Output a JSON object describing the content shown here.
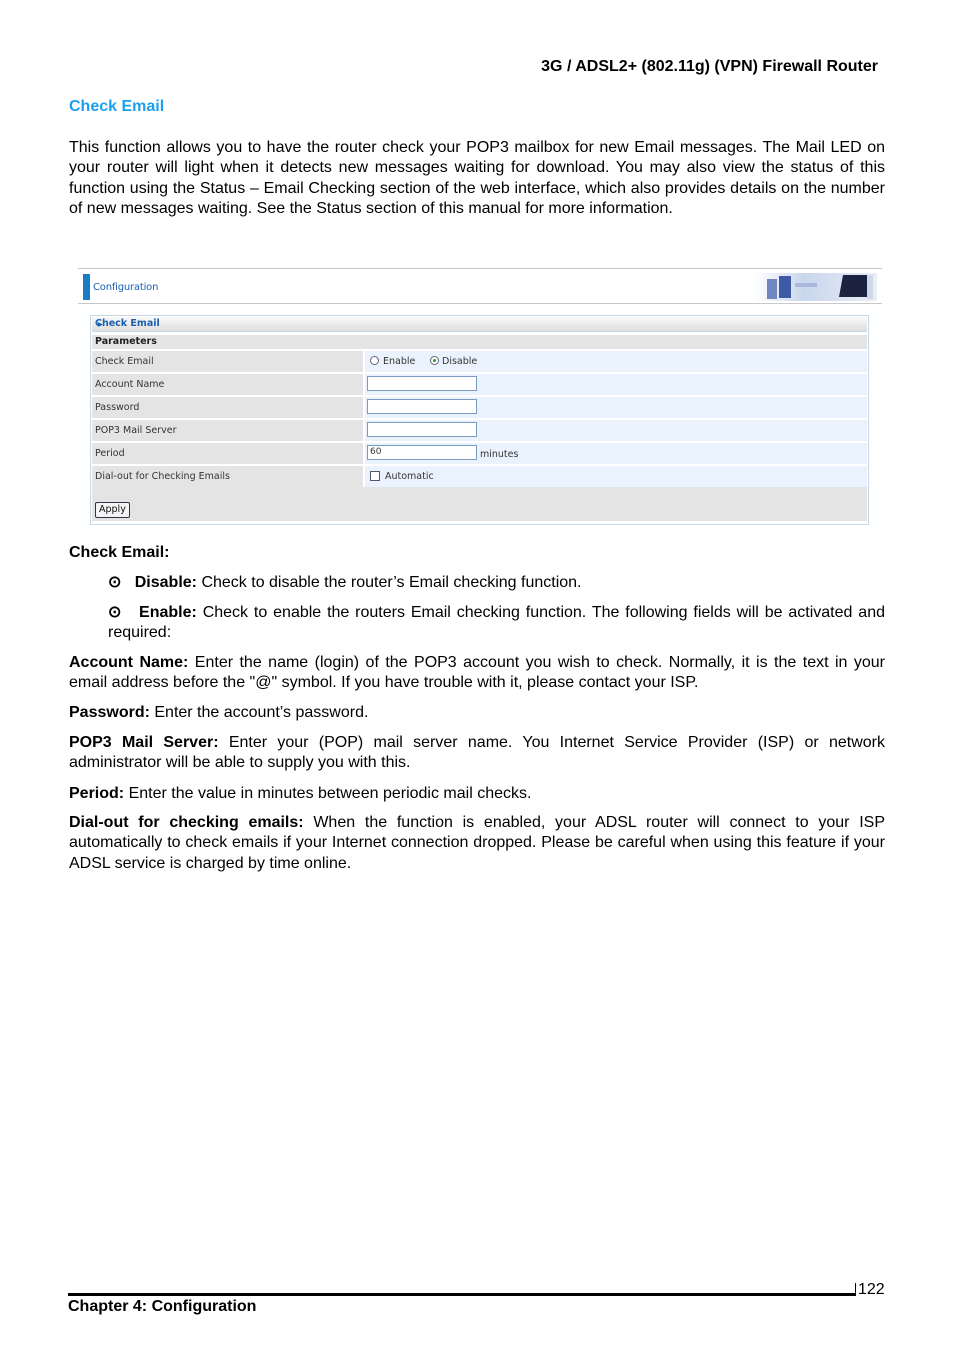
{
  "header": {
    "product": "3G / ADSL2+ (802.11g) (VPN) Firewall Router"
  },
  "section": {
    "title": "Check Email",
    "intro": "This function allows you to have the router check your POP3 mailbox for new Email messages. The Mail LED on your router will light when it detects new messages waiting for download. You may also view the status of this function using the Status – Email Checking section of the web interface, which also provides details on the number of new messages waiting. See the Status section of this manual for more information."
  },
  "screenshot": {
    "bar_title": "Configuration",
    "form_title": "Check Email",
    "params_label": "Parameters",
    "rows": {
      "check_email": {
        "label": "Check Email",
        "options": [
          "Enable",
          "Disable"
        ],
        "selected": "Disable"
      },
      "account_name": {
        "label": "Account Name",
        "value": ""
      },
      "password": {
        "label": "Password",
        "value": ""
      },
      "pop3_server": {
        "label": "POP3 Mail Server",
        "value": ""
      },
      "period": {
        "label": "Period",
        "value": "60",
        "unit": "minutes"
      },
      "dialout": {
        "label": "Dial-out for Checking Emails",
        "checkbox_label": "Automatic",
        "checked": false
      }
    },
    "apply_label": "Apply"
  },
  "descriptions": {
    "check_email_heading": "Check Email:",
    "disable": {
      "term": "Disable:",
      "text": " Check to disable the router’s Email checking function."
    },
    "enable": {
      "term": "Enable:",
      "text": " Check to enable the routers Email checking function. The following fields will be activated and required:"
    },
    "account_name": {
      "term": "Account Name:",
      "text": " Enter the name (login) of the POP3 account you wish to check. Normally, it is the text in your email address before the \"@\" symbol. If you have trouble with it, please contact your ISP."
    },
    "password": {
      "term": "Password:",
      "text": " Enter the account’s password."
    },
    "pop3": {
      "term": "POP3 Mail Server:",
      "text": " Enter your (POP) mail server name. You Internet Service Provider (ISP) or network administrator will be able to supply you with this."
    },
    "period": {
      "term": "Period:",
      "text": " Enter the value in minutes between periodic mail checks."
    },
    "dialout": {
      "term": "Dial-out for checking emails:",
      "text": " When the function is enabled, your ADSL router will connect to your ISP automatically to check emails if your Internet connection dropped. Please be careful when using this feature if your ADSL service is charged by time online."
    }
  },
  "footer": {
    "page_number": "122",
    "chapter": "Chapter 4: Configuration"
  }
}
